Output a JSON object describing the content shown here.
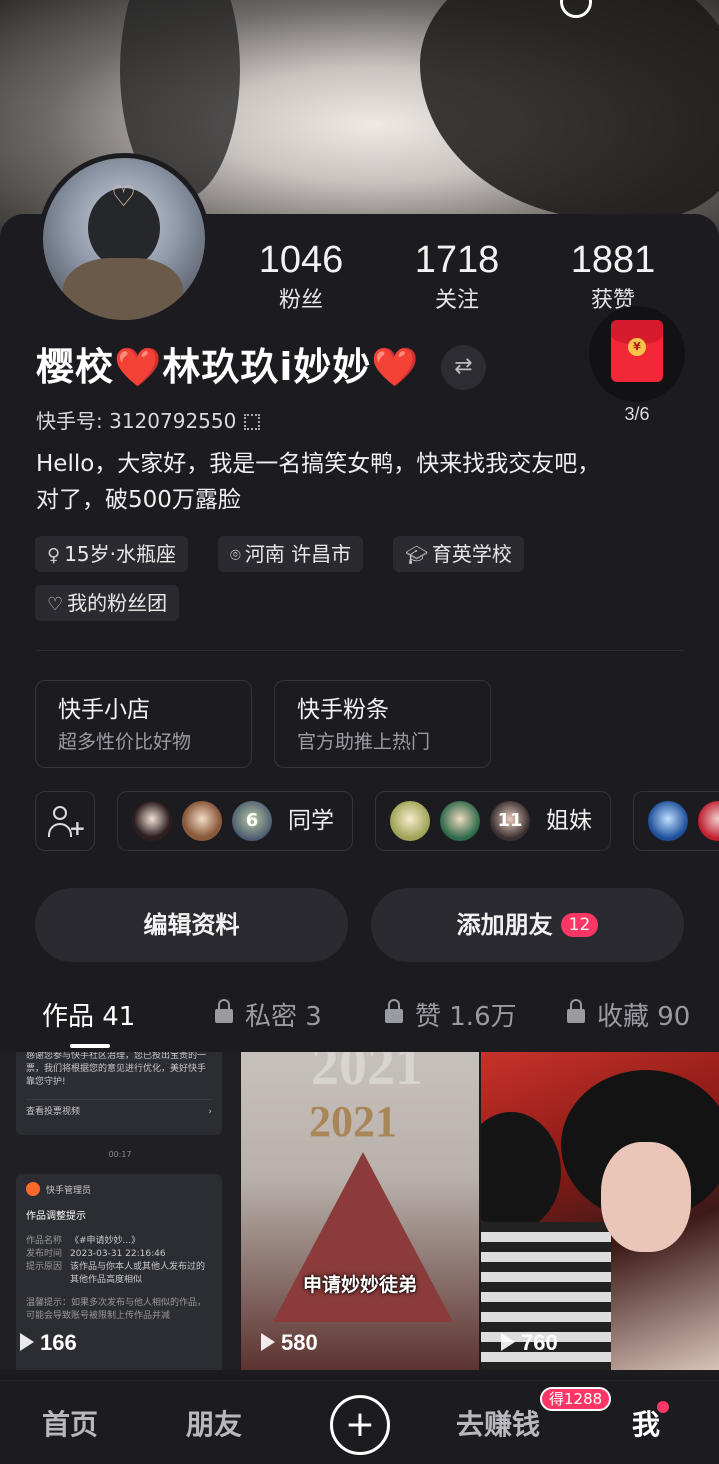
{
  "profile": {
    "name": "樱校❤️林玖玖i妙妙❤️",
    "kuaishou_id_label": "快手号: 3120792550",
    "bio_line1": "Hello，大家好，我是一名搞笑女鸭，快来找我交友吧，",
    "bio_line2": "对了，破500万露脸"
  },
  "stats": [
    {
      "value": "1046",
      "label": "粉丝"
    },
    {
      "value": "1718",
      "label": "关注"
    },
    {
      "value": "1881",
      "label": "获赞"
    }
  ],
  "red_packet": {
    "count": "3/6",
    "icon": "red-envelope-icon",
    "coin_glyph": "¥"
  },
  "tags": {
    "age": "15岁·水瓶座",
    "location": "河南 许昌市",
    "school": "育英学校",
    "fan_group": "我的粉丝团"
  },
  "cards": {
    "shop_title": "快手小店",
    "shop_subtitle": "超多性价比好物",
    "promo_title": "快手粉条",
    "promo_subtitle": "官方助推上热门"
  },
  "friend_groups": [
    {
      "label": "同学",
      "count": "6"
    },
    {
      "label": "姐妹",
      "count": "11"
    }
  ],
  "buttons": {
    "edit_profile": "编辑资料",
    "add_friends": "添加朋友",
    "add_friends_badge": "12"
  },
  "tabs": [
    {
      "label": "作品 41"
    },
    {
      "label": "私密 3"
    },
    {
      "label": "赞 1.6万"
    },
    {
      "label": "收藏 90"
    }
  ],
  "videos": [
    {
      "views": "166",
      "msg_top": "感谢您参与快手社区治理，您已投出宝贵的一票，我们将根据您的意见进行优化，美好快手靠您守护!",
      "msg_link": "查看投票视频",
      "time": "00:17",
      "sender": "快手管理员",
      "notice_title": "作品调整提示",
      "row1_k": "作品名称",
      "row1_v": "《#申请妙妙...》",
      "row2_k": "发布时间",
      "row2_v": "2023-03-31 22:16:46",
      "row3_k": "提示原因",
      "row3_v": "该作品与你本人或其他人发布过的其他作品高度相似",
      "tip": "温馨提示：如果多次发布与他人相似的作品，可能会导致账号被限制上传作品并减"
    },
    {
      "views": "580",
      "year": "2021",
      "caption": "申请妙妙徒弟"
    },
    {
      "views": "760"
    }
  ],
  "nav": {
    "home": "首页",
    "friends": "朋友",
    "earn": "去赚钱",
    "earn_badge": "得1288",
    "me": "我"
  },
  "colors": {
    "accent": "#fe3666",
    "background": "#1b1b20",
    "red_packet": "#f22838"
  }
}
